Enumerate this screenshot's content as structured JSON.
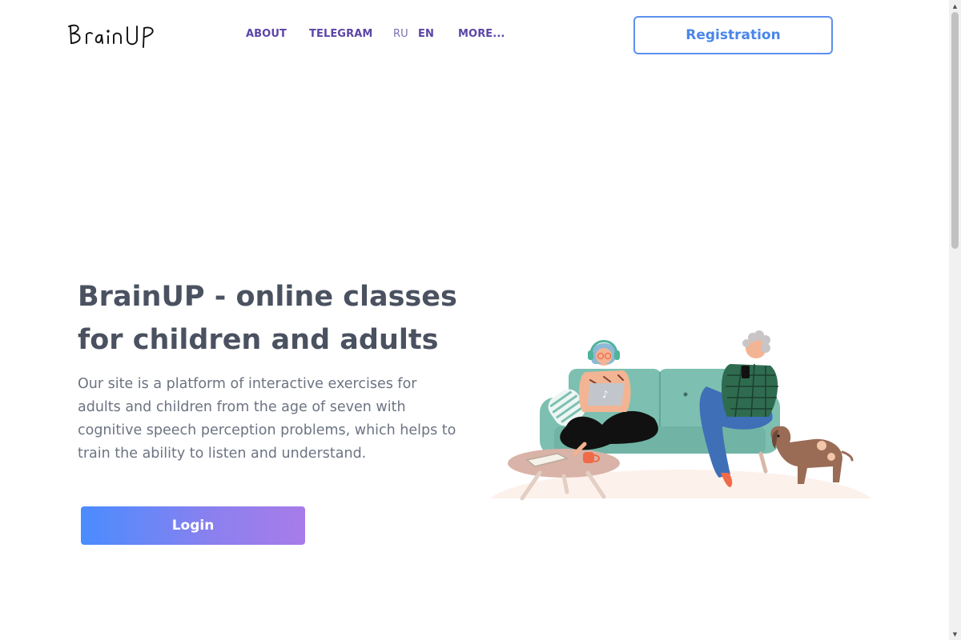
{
  "header": {
    "logo_text": "BrainUP",
    "nav": {
      "about": "ABOUT",
      "telegram": "TELEGRAM",
      "lang_ru": "RU",
      "lang_en": "EN",
      "more": "MORE..."
    },
    "registration_label": "Registration"
  },
  "hero": {
    "title": "BrainUP - online classes for children and adults",
    "description": "Our site is a platform of interactive exercises for adults and children from the age of seven with cognitive speech perception problems, which helps to train the ability to listen and understand.",
    "login_label": "Login"
  },
  "illustration": {
    "icon": "people-on-sofa-illustration"
  },
  "colors": {
    "nav_text": "#5b45a6",
    "accent_blue": "#4a86ea",
    "title": "#4a5160",
    "body_text": "#6c7382",
    "gradient_start": "#4a8cff",
    "gradient_end": "#a87ce9",
    "sofa": "#7dc0b1"
  }
}
